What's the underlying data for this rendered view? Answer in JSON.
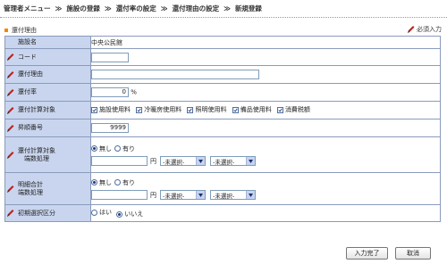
{
  "breadcrumb": {
    "items": [
      "管理者メニュー",
      "施設の登録",
      "還付率の設定",
      "還付理由の設定",
      "新規登録"
    ],
    "separator": "≫"
  },
  "section": {
    "title": "還付理由",
    "required_label": "必須入力"
  },
  "colors": {
    "label_bg": "#c9d5ee",
    "border": "#8a9bbd",
    "accent": "#f08a00",
    "pen": "#c0201e"
  },
  "form": {
    "facility": {
      "label": "施設名",
      "value": "中央公民館"
    },
    "code": {
      "label": "コード",
      "value": ""
    },
    "reason": {
      "label": "還付理由",
      "value": ""
    },
    "rate": {
      "label": "還付率",
      "value": "0",
      "unit": "%"
    },
    "targets": {
      "label": "還付計算対象",
      "options": [
        "施設使用料",
        "冷暖房使用料",
        "照明使用料",
        "備品使用料",
        "消費税額"
      ],
      "checked": [
        true,
        true,
        true,
        true,
        true
      ]
    },
    "sort": {
      "label": "昇順番号",
      "value": "9999"
    },
    "calc_rounding": {
      "label1": "還付計算対象",
      "label2": "端数処理",
      "radio_none": "無し",
      "radio_yes": "有り",
      "selected": "無し",
      "amount": "",
      "yen": "円",
      "select1": "-未選択-",
      "select2": "-未選択-"
    },
    "detail_rounding": {
      "label1": "明細合計",
      "label2": "端数処理",
      "radio_none": "無し",
      "radio_yes": "有り",
      "selected": "無し",
      "amount": "",
      "yen": "円",
      "select1": "-未選択-",
      "select2": "-未選択-"
    },
    "initial": {
      "label": "初期選択区分",
      "radio_yes": "はい",
      "radio_no": "いいえ",
      "selected": "いいえ"
    }
  },
  "buttons": {
    "submit": "入力完了",
    "cancel": "取消"
  }
}
